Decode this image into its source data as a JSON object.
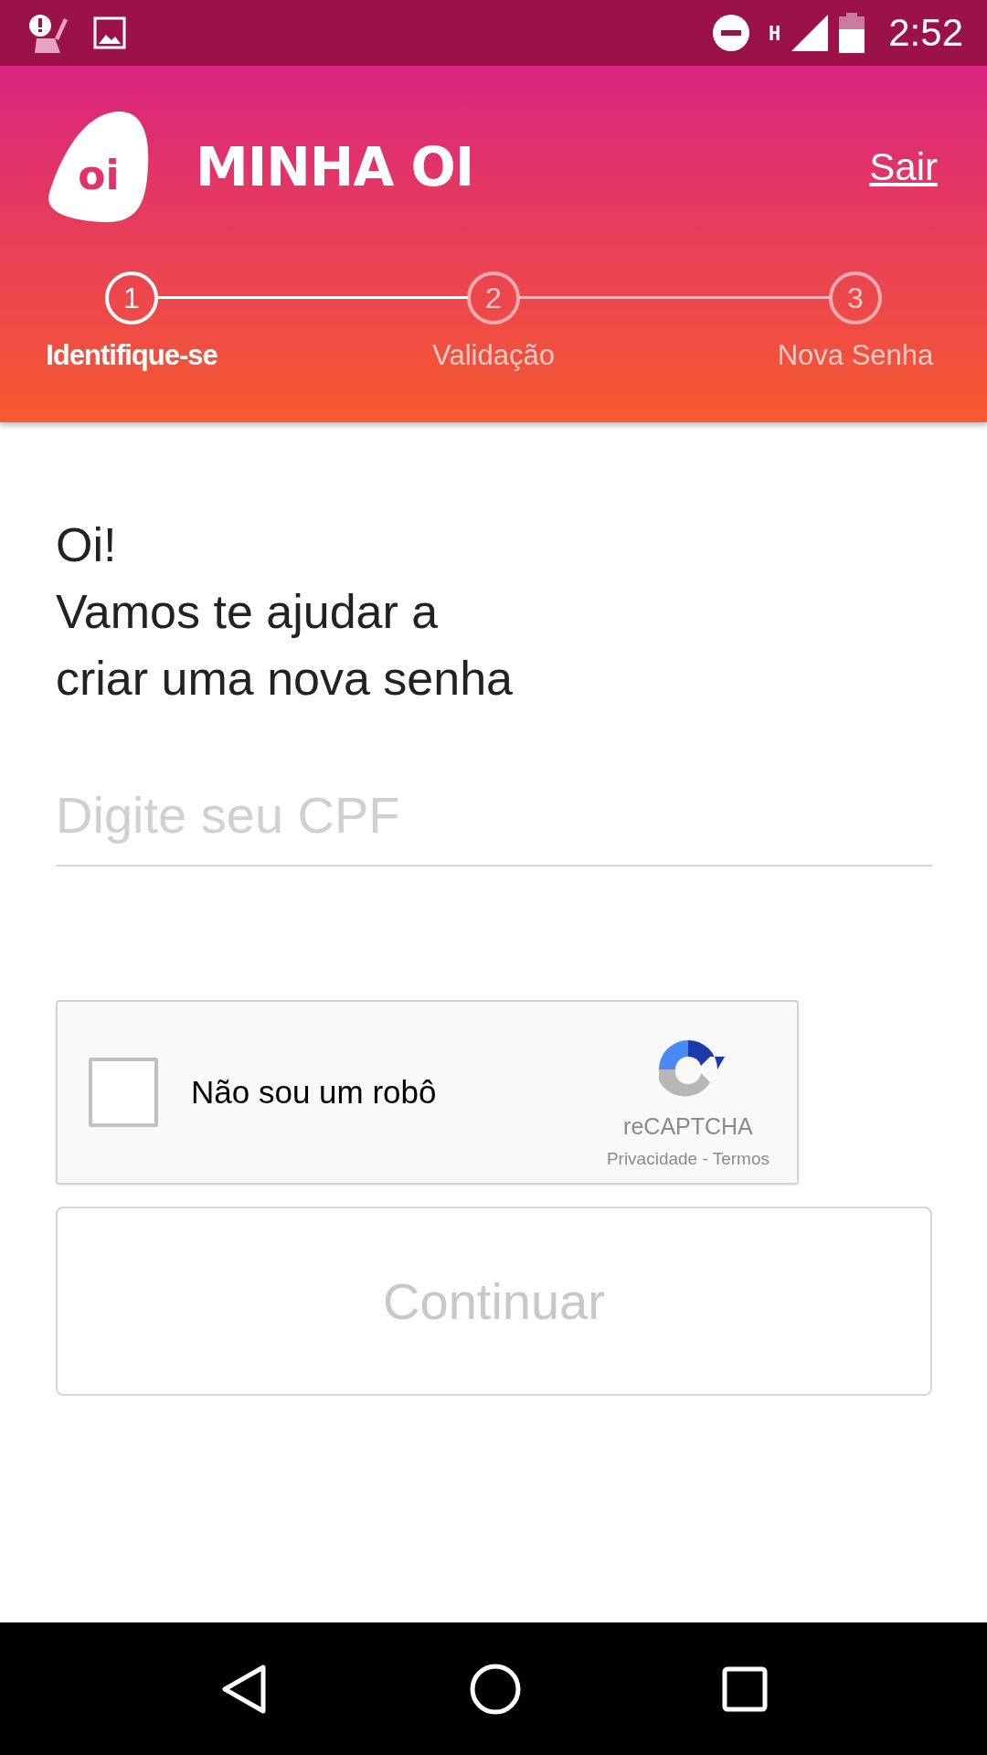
{
  "status_bar": {
    "network_type": "H",
    "time": "2:52"
  },
  "header": {
    "title": "MINHA OI",
    "logo_text": "oi",
    "logout_link": "Sair"
  },
  "steps": [
    {
      "number": "1",
      "label": "Identifique-se",
      "selected": true
    },
    {
      "number": "2",
      "label": "Validação",
      "selected": false
    },
    {
      "number": "3",
      "label": "Nova Senha",
      "selected": false
    }
  ],
  "greeting": [
    "Oi!",
    "Vamos te ajudar a",
    "criar uma nova senha"
  ],
  "cpf_field": {
    "placeholder": "Digite seu CPF"
  },
  "recaptcha": {
    "label": "Não sou um robô",
    "checked": false,
    "brand": "reCAPTCHA",
    "links": "Privacidade - Termos"
  },
  "continue_button": {
    "label": "Continuar",
    "disabled": true
  }
}
